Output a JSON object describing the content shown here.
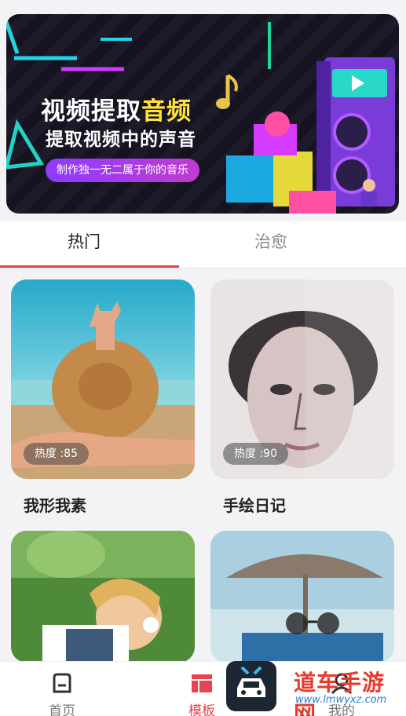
{
  "banner": {
    "title_part1": "视频提取",
    "title_highlight": "音频",
    "subtitle": "提取视频中的声音",
    "pill_text": "制作独一无二属于你的音乐"
  },
  "tabs": [
    {
      "label": "热门",
      "active": true
    },
    {
      "label": "治愈",
      "active": false
    }
  ],
  "cards": [
    {
      "name": "我形我素",
      "heat": "热度 :85"
    },
    {
      "name": "手绘日记",
      "heat": "热度 :90"
    },
    {
      "name": "",
      "heat": ""
    },
    {
      "name": "",
      "heat": ""
    }
  ],
  "nav": {
    "home": "首页",
    "template": "模板",
    "mine": "我的"
  },
  "watermark": {
    "text": "道车手游网",
    "url": "www.lmwyxz.com"
  },
  "colors": {
    "accent": "#e8434f",
    "highlight": "#ffe33c"
  }
}
